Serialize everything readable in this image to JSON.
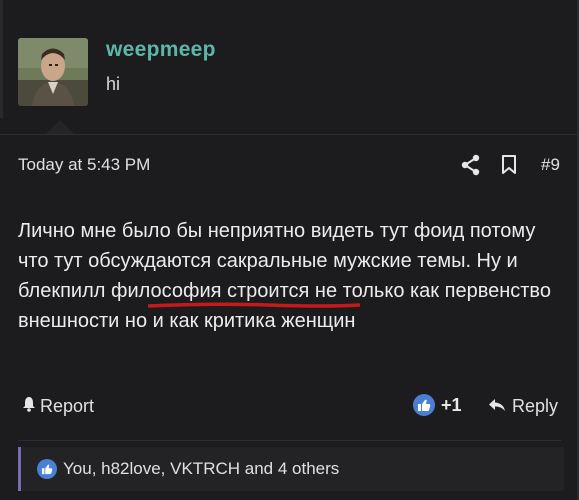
{
  "user": {
    "username": "weepmeep",
    "title": "hi"
  },
  "post": {
    "timestamp": "Today at 5:43 PM",
    "number": "#9",
    "body": "Лично мне было бы неприятно видеть тут фоид потому что тут обсуждаются сакральные мужские темы. Ну и блекпилл философия строится не только как первенство внешности но и как критика женщин"
  },
  "actions": {
    "report_label": "Report",
    "like_count": "+1",
    "reply_label": "Reply"
  },
  "reactions": {
    "summary": "You, h82love, VKTRCH and 4 others"
  },
  "icons": {
    "share": "share-icon",
    "bookmark": "bookmark-icon",
    "like": "thumbs-up-icon",
    "report": "bell-icon",
    "reply": "reply-arrow-icon"
  },
  "colors": {
    "background": "#1c1c1e",
    "username": "#5db6a8",
    "like": "#4a7fd4",
    "reactions_accent": "#7a6bb4",
    "underline": "#c61a1a"
  }
}
